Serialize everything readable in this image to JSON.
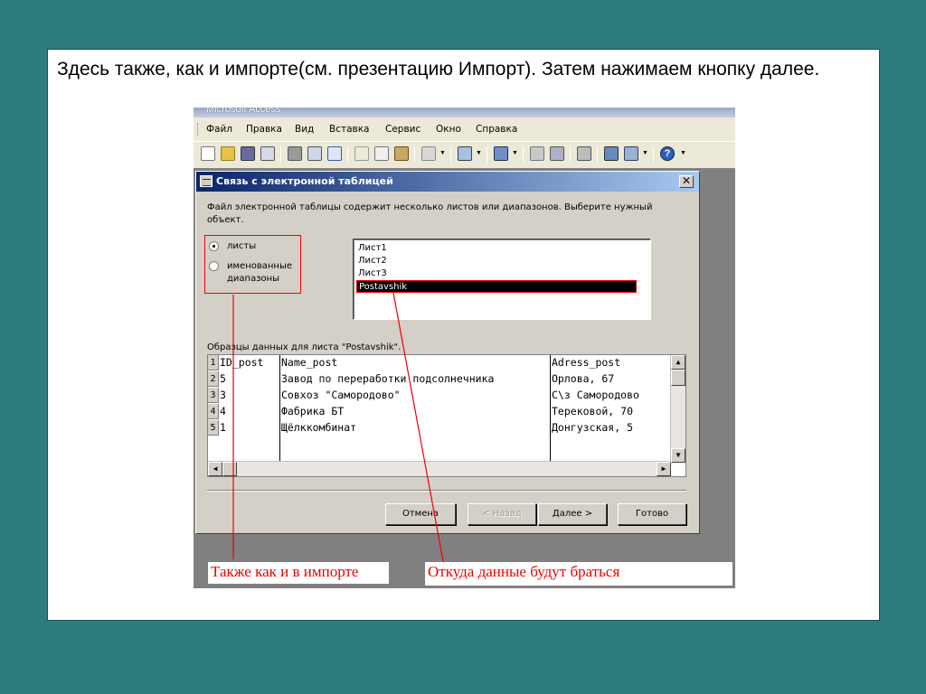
{
  "slide": {
    "caption": "Здесь также, как и импорте(см. презентацию Импорт). Затем нажимаем кнопку далее."
  },
  "app": {
    "window_title": "Microsoft Access",
    "menu": [
      "Файл",
      "Правка",
      "Вид",
      "Вставка",
      "Сервис",
      "Окно",
      "Справка"
    ],
    "toolbar_icons": [
      "new-icon",
      "open-icon",
      "save-icon",
      "search-icon",
      "print-icon",
      "preview-icon",
      "spelling-icon",
      "cut-icon",
      "copy-icon",
      "paste-icon",
      "undo-icon",
      "analyze-icon",
      "office-links-icon",
      "code-icon",
      "relationships-icon",
      "properties-icon",
      "database-window-icon",
      "new-object-icon",
      "help-icon"
    ]
  },
  "dialog": {
    "title": "Связь с электронной таблицей",
    "close": "✕",
    "intro": "Файл электронной таблицы содержит несколько листов или диапазонов.  Выберите нужный объект.",
    "radio_sheets": "листы",
    "radio_ranges": "именованные диапазоны",
    "sheets": [
      "Лист1",
      "Лист2",
      "Лист3",
      "Postavshik"
    ],
    "selected_sheet": "Postavshik",
    "sample_label": "Образцы данных для листа \"Postavshik\".",
    "grid": {
      "rows": [
        {
          "n": "1",
          "id": "ID_post",
          "name": "Name_post",
          "addr": "Adress_post"
        },
        {
          "n": "2",
          "id": "5",
          "name": "Завод по переработки подсолнечника",
          "addr": "Орлова, 67"
        },
        {
          "n": "3",
          "id": "3",
          "name": "Совхоз \"Самородово\"",
          "addr": "С\\з Самородово"
        },
        {
          "n": "4",
          "id": "4",
          "name": "Фабрика БТ",
          "addr": "Терековой, 70"
        },
        {
          "n": "5",
          "id": "1",
          "name": "Щёлккомбинат",
          "addr": "Донгузская, 5"
        }
      ]
    },
    "buttons": {
      "cancel": "Отмена",
      "back": "< Назад",
      "next": "Далее >",
      "finish": "Готово"
    }
  },
  "annotations": {
    "left": "Также как и в импорте",
    "right": "Откуда данные будут браться"
  },
  "colors": {
    "background": "#2d7d7d",
    "annotation_red": "#e00000",
    "dialog_title": "#0a246a"
  }
}
